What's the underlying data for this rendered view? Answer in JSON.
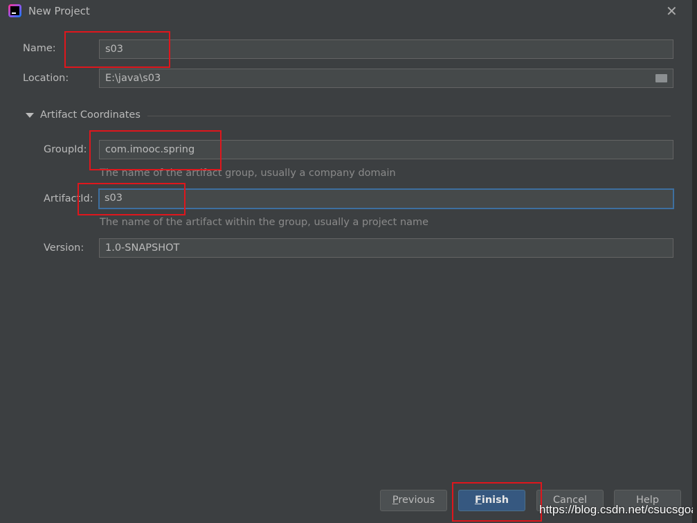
{
  "window": {
    "title": "New Project"
  },
  "form": {
    "name_label": "Name:",
    "name_value": "s03",
    "location_label": "Location:",
    "location_value": "E:\\java\\s03",
    "section_title": "Artifact Coordinates",
    "groupid_label": "GroupId:",
    "groupid_value": "com.imooc.spring",
    "groupid_hint": "The name of the artifact group, usually a company domain",
    "artifactid_label": "ArtifactId:",
    "artifactid_value": "s03",
    "artifactid_hint": "The name of the artifact within the group, usually a project name",
    "version_label": "Version:",
    "version_value": "1.0-SNAPSHOT"
  },
  "buttons": {
    "previous_first": "P",
    "previous_rest": "revious",
    "finish_first": "F",
    "finish_rest": "inish",
    "cancel": "Cancel",
    "help": "Help"
  },
  "watermark": "https://blog.csdn.net/csucsgoat",
  "colors": {
    "background": "#3c3f41",
    "primary": "#365880",
    "annotation": "#e0161c"
  }
}
